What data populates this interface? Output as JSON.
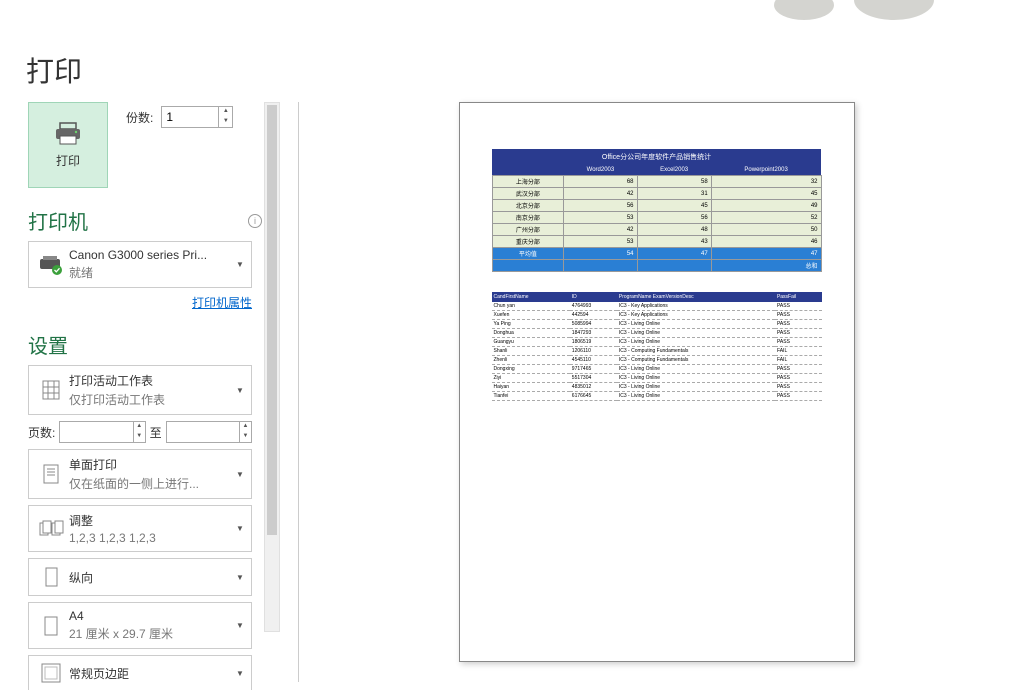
{
  "page_title": "打印",
  "print_button_label": "打印",
  "copies": {
    "label": "份数:",
    "value": "1"
  },
  "printer_section": {
    "title": "打印机",
    "selected": {
      "name": "Canon G3000 series Pri...",
      "status": "就绪"
    },
    "properties_link": "打印机属性"
  },
  "settings_section": {
    "title": "设置",
    "active_sheet": {
      "main": "打印活动工作表",
      "sub": "仅打印活动工作表"
    },
    "pages": {
      "label": "页数:",
      "to_label": "至",
      "from": "",
      "to": ""
    },
    "sides": {
      "main": "单面打印",
      "sub": "仅在纸面的一侧上进行..."
    },
    "collate": {
      "main": "调整",
      "sub": "1,2,3    1,2,3    1,2,3"
    },
    "orientation": {
      "main": "纵向",
      "sub": ""
    },
    "paper": {
      "main": "A4",
      "sub": "21 厘米 x 29.7 厘米"
    },
    "margins": {
      "main": "常规页边距",
      "sub": ""
    }
  },
  "preview": {
    "table1": {
      "title": "Office分公司年度软件产品销售统计",
      "headers": [
        "",
        "Word2003",
        "Excel2003",
        "Powerpoint2003"
      ],
      "rows": [
        [
          "上海分部",
          "68",
          "58",
          "32"
        ],
        [
          "武汉分部",
          "42",
          "31",
          "45"
        ],
        [
          "北京分部",
          "56",
          "45",
          "49"
        ],
        [
          "南京分部",
          "53",
          "56",
          "52"
        ],
        [
          "广州分部",
          "42",
          "48",
          "50"
        ],
        [
          "重庆分部",
          "53",
          "43",
          "46"
        ],
        [
          "平均值",
          "54",
          "47",
          "47"
        ]
      ],
      "total_label": "总和"
    },
    "table2": {
      "headers": [
        "CandFirstName",
        "ID",
        "ProgramName ExamVersionDesc",
        "PassFail"
      ],
      "rows": [
        [
          "Chun yan",
          "4764993",
          "IC3 - Key Applications",
          "PASS"
        ],
        [
          "Xuefen",
          "442594",
          "IC3 - Key Applications",
          "PASS"
        ],
        [
          "Ya Ping",
          "5085994",
          "IC3 - Living Online",
          "PASS"
        ],
        [
          "Donghua",
          "1847293",
          "IC3 - Living Online",
          "PASS"
        ],
        [
          "Guangyu",
          "1806519",
          "IC3 - Living Online",
          "PASS"
        ],
        [
          "Shanli",
          "1206110",
          "IC3 - Computing Fundamentals",
          "FAIL"
        ],
        [
          "Zhenli",
          "4545110",
          "IC3 - Computing Fundamentals",
          "FAIL"
        ],
        [
          "Dongxing",
          "9717465",
          "IC3 - Living Online",
          "PASS"
        ],
        [
          "Ziyi",
          "5517304",
          "IC3 - Living Online",
          "PASS"
        ],
        [
          "Haiyan",
          "4835012",
          "IC3 - Living Online",
          "PASS"
        ],
        [
          "Tianfei",
          "6176645",
          "IC3 - Living Online",
          "PASS"
        ]
      ]
    }
  }
}
